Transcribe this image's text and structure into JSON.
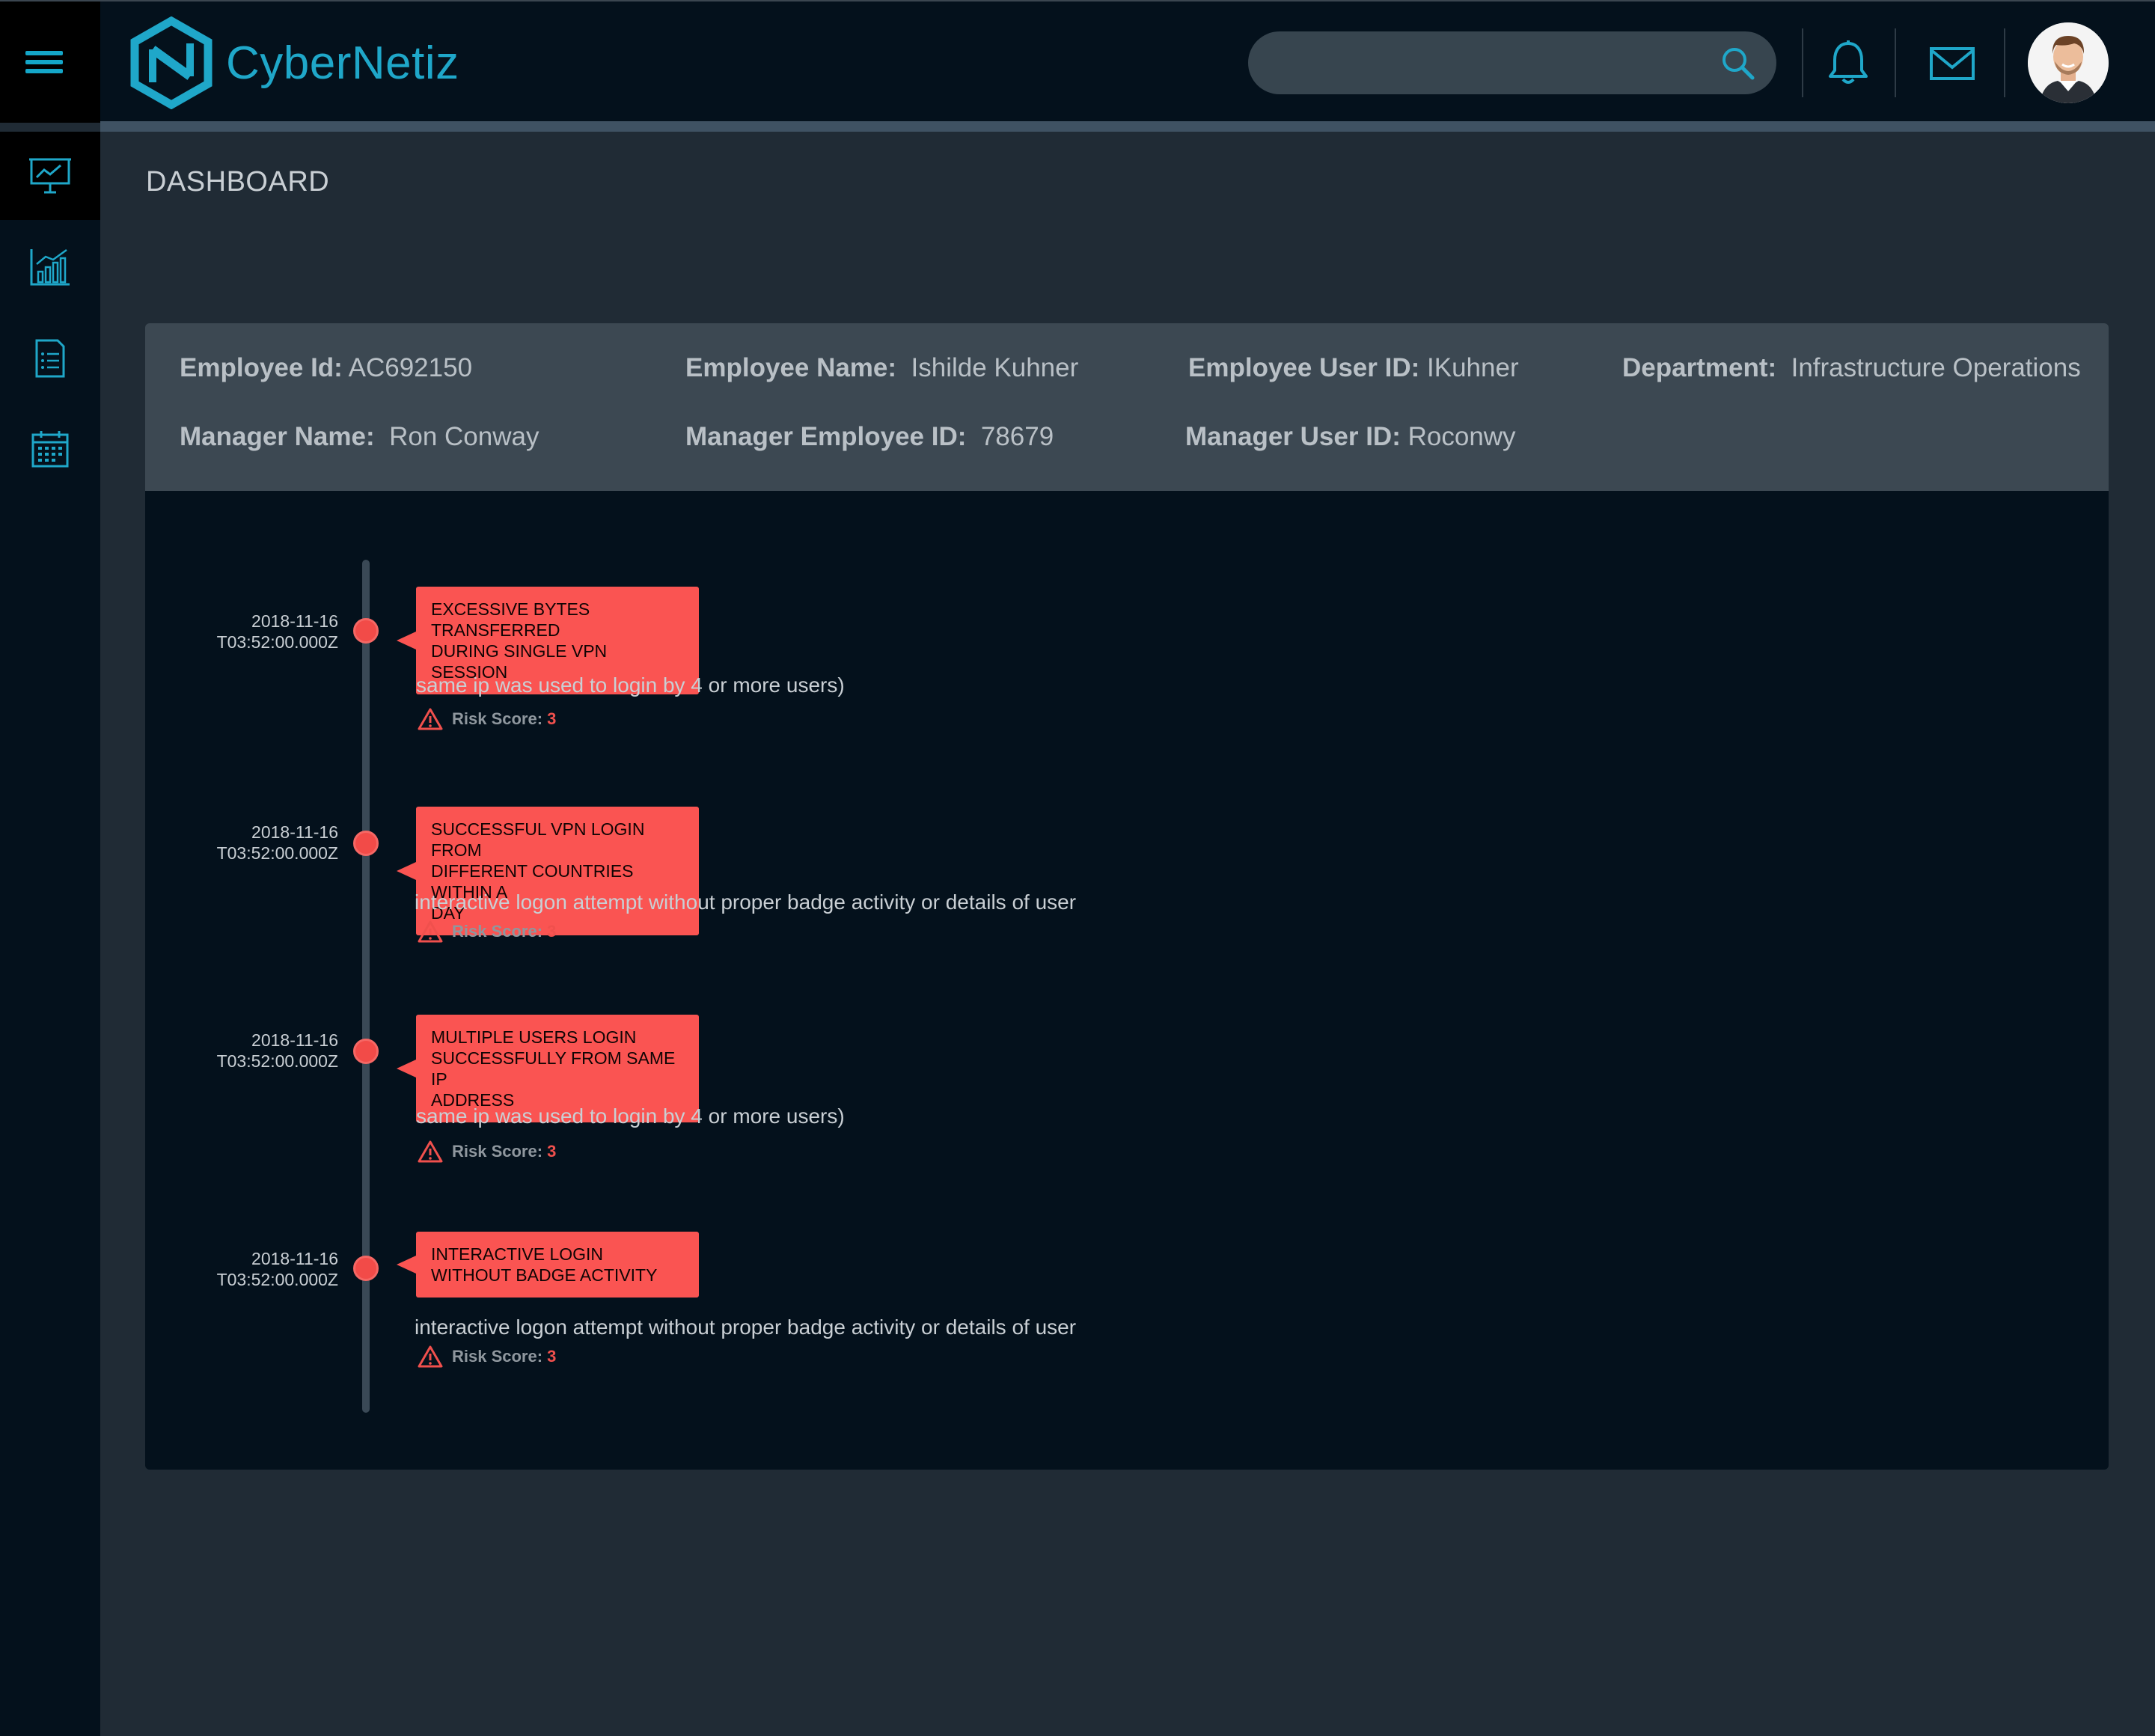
{
  "app": {
    "name": "CyberNetiz"
  },
  "header": {
    "search_placeholder": "",
    "icons": [
      "menu-icon",
      "search-icon",
      "bell-icon",
      "mail-icon",
      "avatar"
    ]
  },
  "sidebar": {
    "items": [
      {
        "icon": "presentation-chart-icon",
        "active": true
      },
      {
        "icon": "bar-chart-icon",
        "active": false
      },
      {
        "icon": "document-list-icon",
        "active": false
      },
      {
        "icon": "calendar-icon",
        "active": false
      }
    ]
  },
  "page": {
    "title": "DASHBOARD"
  },
  "employee": {
    "id_label": "Employee Id:",
    "id": "AC692150",
    "name_label": "Employee Name:",
    "name": "Ishilde Kuhner",
    "user_id_label": "Employee User ID:",
    "user_id": "IKuhner",
    "department_label": "Department:",
    "department": "Infrastructure Operations",
    "manager_name_label": "Manager Name:",
    "manager_name": "Ron Conway",
    "manager_emp_id_label": "Manager Employee ID:",
    "manager_emp_id": "78679",
    "manager_user_id_label": "Manager User ID:",
    "manager_user_id": "Roconwy"
  },
  "timeline": {
    "risk_label": "Risk Score:",
    "events": [
      {
        "date": "2018-11-16",
        "time": "T03:52:00.000Z",
        "title_line1": "EXCESSIVE BYTES TRANSFERRED",
        "title_line2": "DURING SINGLE VPN SESSION",
        "title_line3": "",
        "description": "same ip was used to login by 4 or more users)",
        "risk_score": "3"
      },
      {
        "date": "2018-11-16",
        "time": "T03:52:00.000Z",
        "title_line1": "SUCCESSFUL VPN LOGIN FROM",
        "title_line2": "DIFFERENT COUNTRIES WITHIN A",
        "title_line3": "DAY",
        "description": "interactive logon attempt without proper badge activity or details of user",
        "risk_score": "3"
      },
      {
        "date": "2018-11-16",
        "time": "T03:52:00.000Z",
        "title_line1": "MULTIPLE USERS LOGIN",
        "title_line2": "SUCCESSFULLY FROM SAME IP",
        "title_line3": "ADDRESS",
        "description": "same ip was used to login by 4 or more users)",
        "risk_score": "3"
      },
      {
        "date": "2018-11-16",
        "time": "T03:52:00.000Z",
        "title_line1": "INTERACTIVE LOGIN",
        "title_line2": "WITHOUT BADGE ACTIVITY",
        "title_line3": "",
        "description": "interactive logon attempt without proper badge activity or details of user",
        "risk_score": "3"
      }
    ]
  },
  "colors": {
    "accent": "#1fa7c9",
    "alert": "#fa5452",
    "background": "#202b35",
    "panel": "#04111c",
    "card_header": "#3c4852"
  }
}
